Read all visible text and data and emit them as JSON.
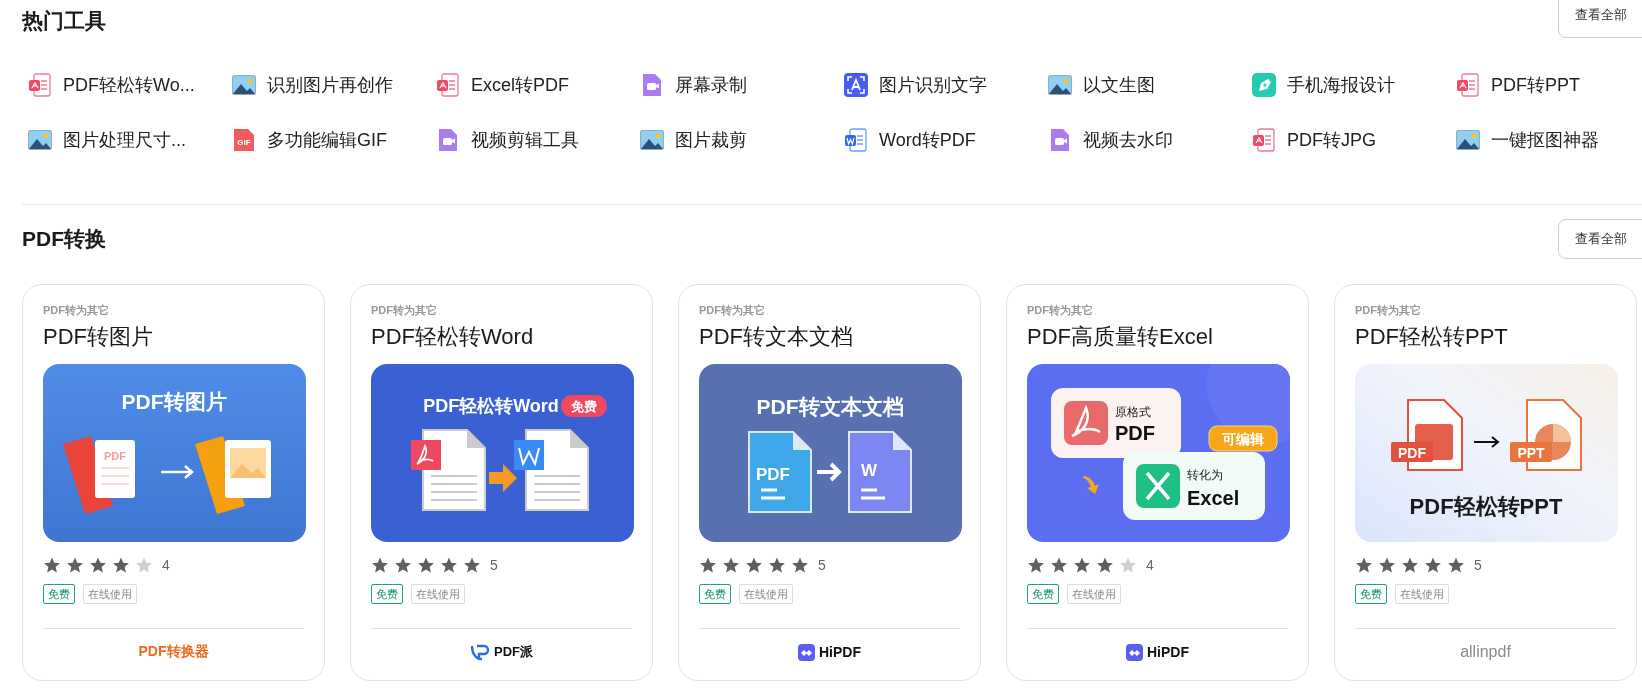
{
  "hot_tools": {
    "title": "热门工具",
    "view_all": "查看全部",
    "items": [
      {
        "kind": "pdf",
        "label": "PDF轻松转Wo..."
      },
      {
        "kind": "image",
        "label": "识别图片再创作"
      },
      {
        "kind": "pdf",
        "label": "Excel转PDF"
      },
      {
        "kind": "video",
        "label": "屏幕录制"
      },
      {
        "kind": "ocr",
        "label": "图片识别文字"
      },
      {
        "kind": "image",
        "label": "以文生图"
      },
      {
        "kind": "poster",
        "label": "手机海报设计"
      },
      {
        "kind": "pdf",
        "label": "PDF转PPT"
      },
      {
        "kind": "image",
        "label": "图片处理尺寸..."
      },
      {
        "kind": "gif",
        "label": "多功能编辑GIF",
        "icon_label": "GIF"
      },
      {
        "kind": "video",
        "label": "视频剪辑工具"
      },
      {
        "kind": "image",
        "label": "图片裁剪"
      },
      {
        "kind": "word",
        "label": "Word转PDF"
      },
      {
        "kind": "video",
        "label": "视频去水印"
      },
      {
        "kind": "pdf",
        "label": "PDF转JPG"
      },
      {
        "kind": "image",
        "label": "一键抠图神器"
      }
    ]
  },
  "pdf_convert": {
    "title": "PDF转换",
    "view_all": "查看全部",
    "cards": [
      {
        "category": "PDF转为其它",
        "title": "PDF转图片",
        "banner": {
          "kind": "image",
          "title": "PDF转图片",
          "labels": [
            "PDF"
          ]
        },
        "stars": 4,
        "rating": "4",
        "tags": [
          {
            "kind": "free",
            "text": "免费"
          },
          {
            "kind": "plain",
            "text": "在线使用"
          }
        ],
        "brand": {
          "kind": "converter",
          "name": "PDF转换器"
        }
      },
      {
        "category": "PDF转为其它",
        "title": "PDF轻松转Word",
        "banner": {
          "kind": "word",
          "title": "PDF轻松转Word",
          "badge": "免费"
        },
        "stars": 5,
        "rating": "5",
        "tags": [
          {
            "kind": "free",
            "text": "免费"
          },
          {
            "kind": "plain",
            "text": "在线使用"
          }
        ],
        "brand": {
          "kind": "pai",
          "name": "PDF派"
        }
      },
      {
        "category": "PDF转为其它",
        "title": "PDF转文本文档",
        "banner": {
          "kind": "text",
          "title": "PDF转文本文档",
          "labels": [
            "PDF",
            "W"
          ]
        },
        "stars": 5,
        "rating": "5",
        "tags": [
          {
            "kind": "free",
            "text": "免费"
          },
          {
            "kind": "plain",
            "text": "在线使用"
          }
        ],
        "brand": {
          "kind": "hipdf",
          "name": "HiPDF"
        }
      },
      {
        "category": "PDF转为其它",
        "title": "PDF高质量转Excel",
        "banner": {
          "kind": "excel",
          "badge": "可编辑",
          "labels": [
            "原格式",
            "PDF",
            "转化为",
            "Excel"
          ]
        },
        "stars": 4,
        "rating": "4",
        "tags": [
          {
            "kind": "free",
            "text": "免费"
          },
          {
            "kind": "plain",
            "text": "在线使用"
          }
        ],
        "brand": {
          "kind": "hipdf",
          "name": "HiPDF"
        }
      },
      {
        "category": "PDF转为其它",
        "title": "PDF轻松转PPT",
        "banner": {
          "kind": "ppt",
          "title": "PDF轻松转PPT",
          "labels": [
            "PDF",
            "PPT"
          ]
        },
        "stars": 5,
        "rating": "5",
        "tags": [
          {
            "kind": "free",
            "text": "免费"
          },
          {
            "kind": "plain",
            "text": "在线使用"
          }
        ],
        "brand": {
          "kind": "allinpdf",
          "name": "allinpdf"
        }
      }
    ]
  }
}
